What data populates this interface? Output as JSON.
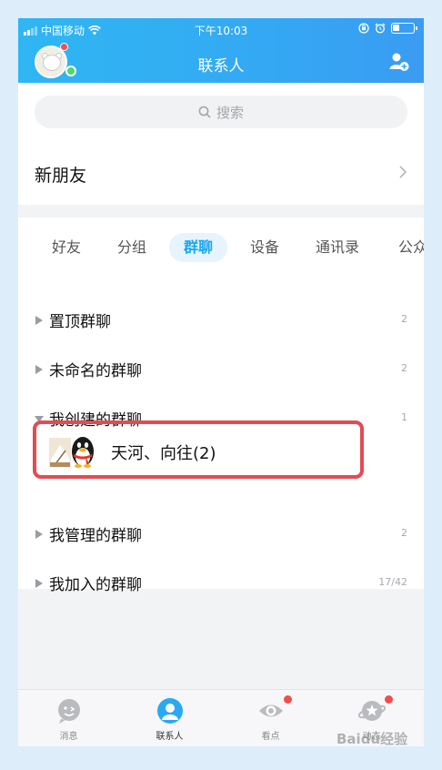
{
  "status_bar": {
    "carrier": "中国移动",
    "time": "下午10:03",
    "battery_level": 0.35,
    "wifi_icon": "wifi-icon",
    "alarm_icon": "alarm-icon",
    "lock_icon": "orientation-lock-icon"
  },
  "header": {
    "title": "联系人",
    "avatar_icon": "user-avatar",
    "add_icon": "add-contact-icon"
  },
  "search": {
    "placeholder": "搜索",
    "icon": "search-icon"
  },
  "new_friends": {
    "label": "新朋友",
    "chevron_icon": "chevron-right-icon"
  },
  "tabs": [
    {
      "label": "好友",
      "active": false
    },
    {
      "label": "分组",
      "active": false
    },
    {
      "label": "群聊",
      "active": true
    },
    {
      "label": "设备",
      "active": false
    },
    {
      "label": "通讯录",
      "active": false
    },
    {
      "label": "公众",
      "active": false
    }
  ],
  "groups": [
    {
      "name": "置顶群聊",
      "count": "2",
      "expanded": false
    },
    {
      "name": "未命名的群聊",
      "count": "2",
      "expanded": false
    },
    {
      "name": "我创建的群聊",
      "count": "1",
      "expanded": true
    },
    {
      "name": "我管理的群聊",
      "count": "2",
      "expanded": false
    },
    {
      "name": "我加入的群聊",
      "count": "17/42",
      "expanded": false
    }
  ],
  "group_item": {
    "title": "天河、向往(2)",
    "avatar_icon": "group-avatar"
  },
  "bottom_tabs": [
    {
      "label": "消息",
      "icon": "message-icon",
      "badge": false,
      "active": false
    },
    {
      "label": "联系人",
      "icon": "contacts-icon",
      "badge": false,
      "active": true
    },
    {
      "label": "看点",
      "icon": "watch-icon",
      "badge": true,
      "active": false
    },
    {
      "label": "动态",
      "icon": "star-planet-icon",
      "badge": true,
      "active": false
    }
  ],
  "colors": {
    "accent": "#18a7ef",
    "header_start": "#2fb6f3",
    "header_end": "#3a9cf2",
    "highlight": "#e04d52",
    "badge": "#f54b4b"
  },
  "watermark": "Baidu经验"
}
